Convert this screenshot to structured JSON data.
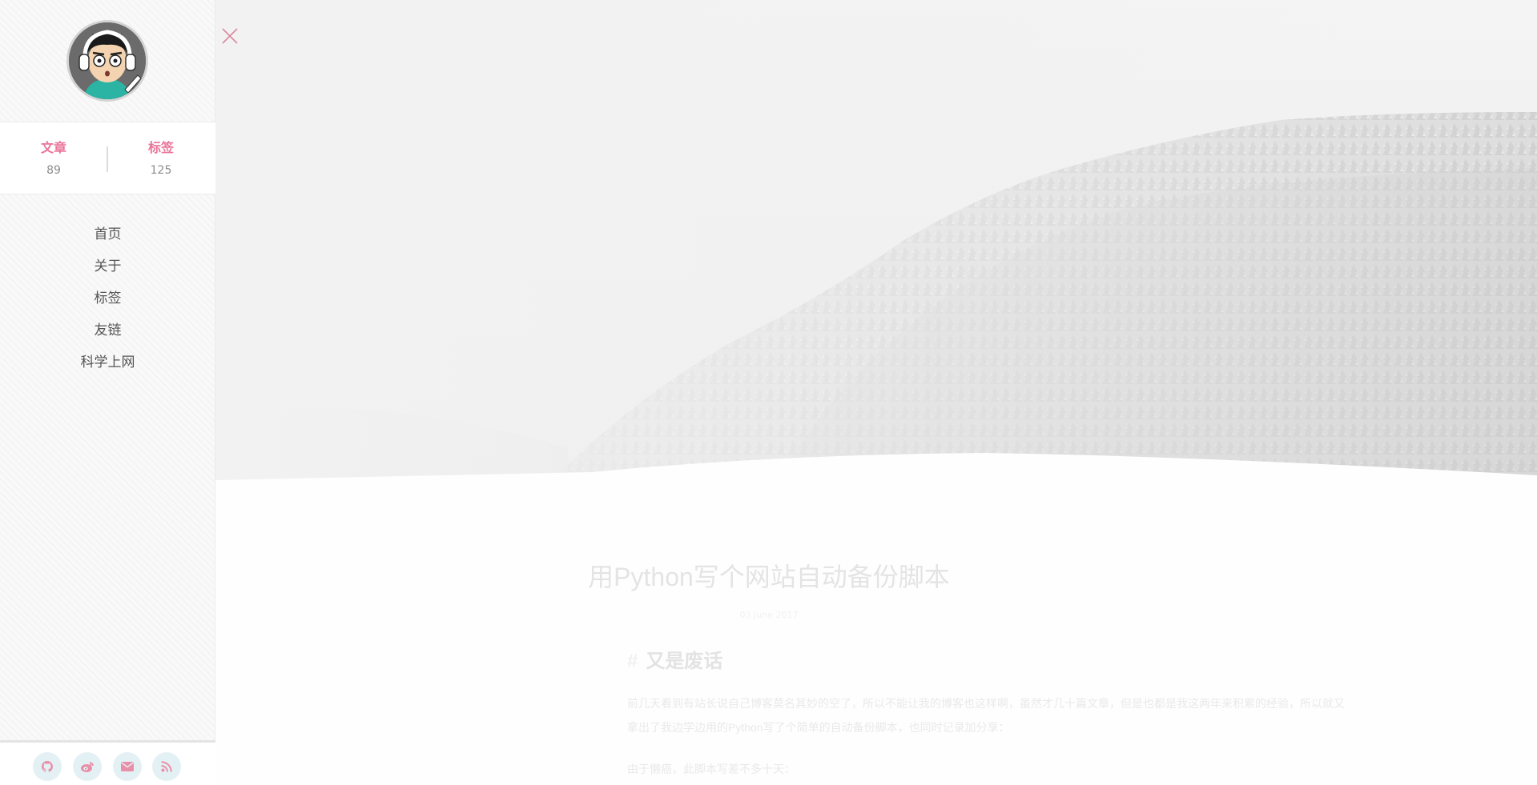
{
  "sidebar": {
    "avatar_alt": "avatar",
    "stats": [
      {
        "label": "文章",
        "value": "89"
      },
      {
        "label": "标签",
        "value": "125"
      }
    ],
    "nav": [
      {
        "label": "首页"
      },
      {
        "label": "关于"
      },
      {
        "label": "标签"
      },
      {
        "label": "友链"
      },
      {
        "label": "科学上网"
      }
    ],
    "social": [
      {
        "icon": "github-icon"
      },
      {
        "icon": "weibo-icon"
      },
      {
        "icon": "email-icon"
      },
      {
        "icon": "rss-icon"
      }
    ]
  },
  "header": {
    "close_icon": "close-icon"
  },
  "article": {
    "title": "用Python写个网站自动备份脚本",
    "date": "03 June 2017",
    "section": {
      "hash": "#",
      "heading": "又是废话"
    },
    "paragraphs": [
      "前几天看到有站长说自己博客莫名其妙的空了，所以不能让我的博客也这样啊，虽然才几十篇文章，但是也都是我这两年来积累的经验，所以就又拿出了我边学边用的Python写了个简单的自动备份脚本，也同时记录加分享：",
      "由于懒癌，此脚本写差不多十天："
    ]
  },
  "colors": {
    "accent": "#e9759a",
    "social_bg": "#e3f1f5",
    "social_icon": "#e98fa8"
  }
}
